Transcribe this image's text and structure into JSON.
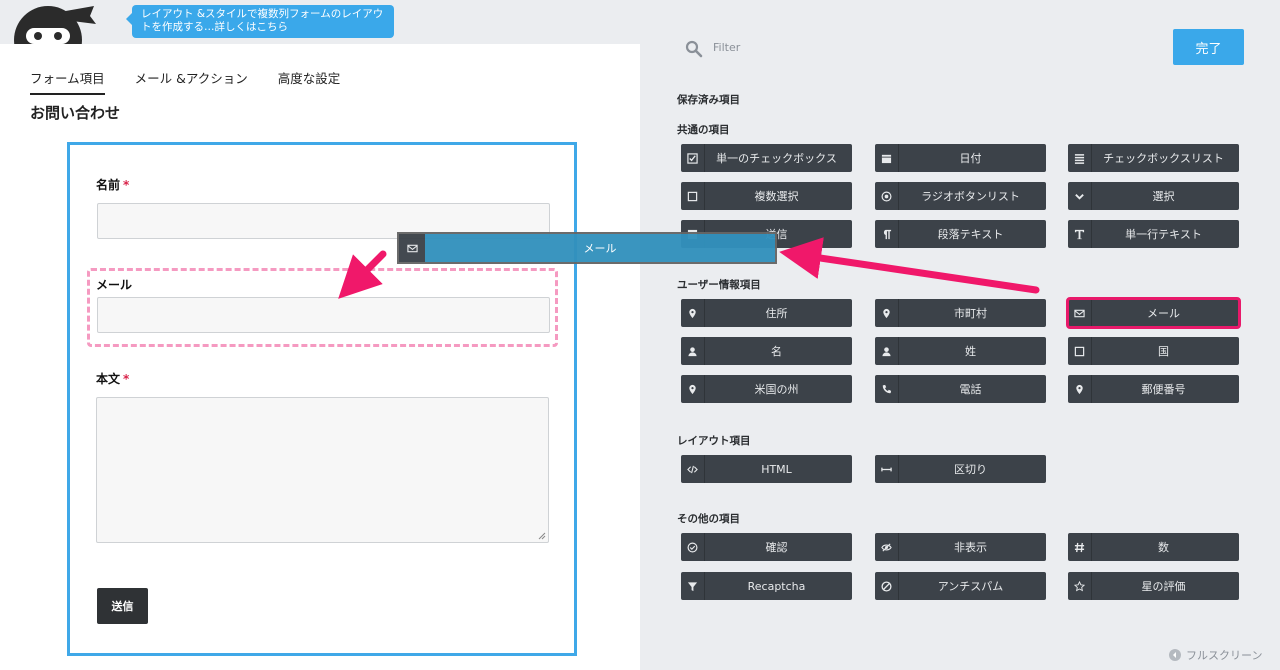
{
  "tooltip": "レイアウト &スタイルで複数列フォームのレイアウトを作成する…詳しくはこちら",
  "tabs": [
    "フォーム項目",
    "メール &アクション",
    "高度な設定"
  ],
  "form": {
    "title": "お問い合わせ",
    "fields": {
      "name_label": "名前",
      "email_label": "メール",
      "body_label": "本文",
      "required_mark": "*"
    },
    "submit_label": "送信"
  },
  "filter_placeholder": "Filter",
  "done_label": "完了",
  "sections": {
    "saved": "保存済み項目",
    "common": "共通の項目",
    "user": "ユーザー情報項目",
    "layout": "レイアウト項目",
    "other": "その他の項目"
  },
  "common_fields": [
    {
      "label": "単一のチェックボックス",
      "icon": "check-square-icon"
    },
    {
      "label": "日付",
      "icon": "calendar-icon"
    },
    {
      "label": "チェックボックスリスト",
      "icon": "list-icon"
    },
    {
      "label": "複数選択",
      "icon": "square-icon"
    },
    {
      "label": "ラジオボタンリスト",
      "icon": "radio-icon"
    },
    {
      "label": "選択",
      "icon": "chevron-down-icon"
    },
    {
      "label": "送信",
      "icon": "square-filled-icon"
    },
    {
      "label": "段落テキスト",
      "icon": "paragraph-icon"
    },
    {
      "label": "単一行テキスト",
      "icon": "text-icon"
    }
  ],
  "user_fields": [
    {
      "label": "住所",
      "icon": "map-pin-icon"
    },
    {
      "label": "市町村",
      "icon": "map-pin-icon"
    },
    {
      "label": "メール",
      "icon": "envelope-icon"
    },
    {
      "label": "名",
      "icon": "user-icon"
    },
    {
      "label": "姓",
      "icon": "user-icon"
    },
    {
      "label": "国",
      "icon": "square-icon"
    },
    {
      "label": "米国の州",
      "icon": "map-pin-icon"
    },
    {
      "label": "電話",
      "icon": "phone-icon"
    },
    {
      "label": "郵便番号",
      "icon": "map-pin-icon"
    }
  ],
  "layout_fields": [
    {
      "label": "HTML",
      "icon": "code-icon"
    },
    {
      "label": "区切り",
      "icon": "divider-icon"
    }
  ],
  "other_fields": [
    {
      "label": "確認",
      "icon": "check-circle-icon"
    },
    {
      "label": "非表示",
      "icon": "eye-slash-icon"
    },
    {
      "label": "数",
      "icon": "hash-icon"
    },
    {
      "label": "Recaptcha",
      "icon": "filter-icon"
    },
    {
      "label": "アンチスパム",
      "icon": "ban-icon"
    },
    {
      "label": "星の評価",
      "icon": "star-icon"
    }
  ],
  "dragging_label": "メール",
  "fullscreen_label": "フルスクリーン",
  "colors": {
    "accent": "#3aa8ea",
    "field_button": "#3c4249",
    "highlight": "#e8196a",
    "drop_zone": "#f59ac1",
    "arrow": "#f0186a"
  }
}
